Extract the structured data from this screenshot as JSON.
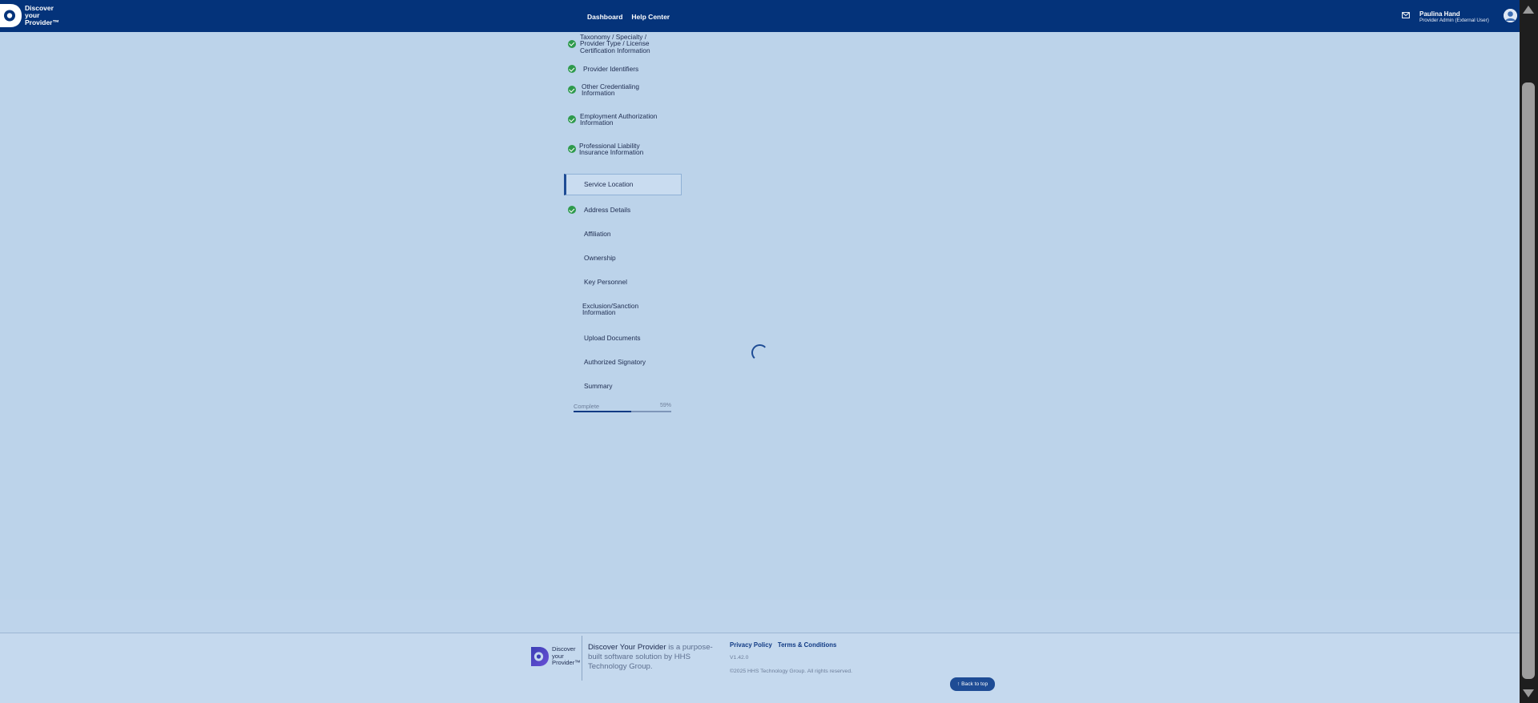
{
  "header": {
    "brand_lines": [
      "Discover",
      "your",
      "Provider"
    ],
    "nav": [
      "Dashboard",
      "Help Center"
    ],
    "user_name": "Paulina Hand",
    "user_role": "Provider Admin (External User)"
  },
  "steps": [
    {
      "label": "Taxonomy / Specialty / Provider Type / License Certification Information",
      "lines": [
        "Taxonomy / Specialty /",
        "Provider Type / License",
        "Certification Information"
      ],
      "completed": true,
      "active": false
    },
    {
      "label": "Provider Identifiers",
      "lines": [
        "Provider Identifiers"
      ],
      "completed": true,
      "active": false
    },
    {
      "label": "Other Credentialing Information",
      "lines": [
        "Other Credentialing",
        "Information"
      ],
      "completed": true,
      "active": false
    },
    {
      "label": "Employment Authorization Information",
      "lines": [
        "Employment Authorization",
        "Information"
      ],
      "completed": true,
      "active": false
    },
    {
      "label": "Professional Liability Insurance Information",
      "lines": [
        "Professional Liability",
        "Insurance Information"
      ],
      "completed": true,
      "active": false
    },
    {
      "label": "Service Location",
      "lines": [
        "Service Location"
      ],
      "completed": false,
      "active": true
    },
    {
      "label": "Address Details",
      "lines": [
        "Address Details"
      ],
      "completed": true,
      "active": false
    },
    {
      "label": "Affiliation",
      "lines": [
        "Affiliation"
      ],
      "completed": false,
      "active": false
    },
    {
      "label": "Ownership",
      "lines": [
        "Ownership"
      ],
      "completed": false,
      "active": false
    },
    {
      "label": "Key Personnel",
      "lines": [
        "Key Personnel"
      ],
      "completed": false,
      "active": false
    },
    {
      "label": "Exclusion/Sanction Information",
      "lines": [
        "Exclusion/Sanction",
        "Information"
      ],
      "completed": false,
      "active": false
    },
    {
      "label": "Upload Documents",
      "lines": [
        "Upload Documents"
      ],
      "completed": false,
      "active": false
    },
    {
      "label": "Authorized Signatory",
      "lines": [
        "Authorized Signatory"
      ],
      "completed": false,
      "active": false
    },
    {
      "label": "Summary",
      "lines": [
        "Summary"
      ],
      "completed": false,
      "active": false
    }
  ],
  "progress": {
    "label": "Complete",
    "percent_text": "59%",
    "fraction": 0.59
  },
  "footer": {
    "brand_lines": [
      "Discover",
      "your",
      "Provider"
    ],
    "product_name": "Discover Your Provider",
    "description": " is a purpose-built software solution by HHS Technology Group.",
    "links": [
      "Privacy Policy",
      "Terms & Conditions"
    ],
    "version": "V1.42.0",
    "copyright": "©2025 HHS Technology Group. All rights reserved.",
    "back_to_top": "Back to top"
  },
  "colors": {
    "header_bg": "#04337a",
    "page_bg": "#bcd3ea",
    "check_green": "#2e9a4c",
    "accent": "#1e4c95"
  }
}
